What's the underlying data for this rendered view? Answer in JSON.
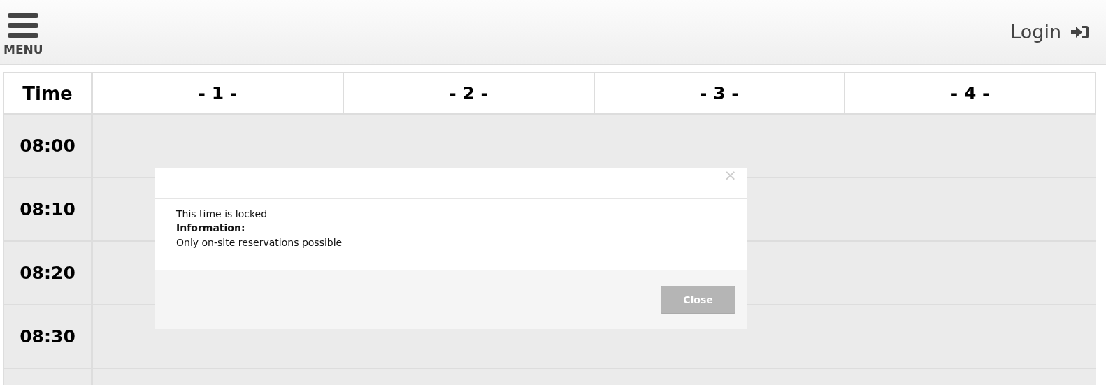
{
  "header": {
    "menu_label": "MENU",
    "login_label": "Login"
  },
  "table": {
    "columns": [
      "Time",
      "- 1 -",
      "- 2 -",
      "- 3 -",
      "- 4 -"
    ],
    "rows": [
      {
        "time": "08:00"
      },
      {
        "time": "08:10"
      },
      {
        "time": "08:20"
      },
      {
        "time": "08:30"
      }
    ]
  },
  "dialog": {
    "lines": [
      "This time is locked",
      "**Information:**",
      "Only on-site reservations possible"
    ],
    "close_button": "Close",
    "close_icon": "×"
  }
}
